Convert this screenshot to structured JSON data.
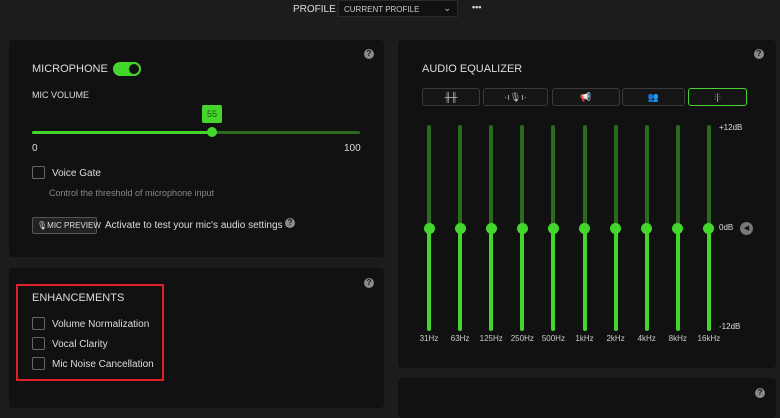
{
  "header": {
    "profile_label": "PROFILE",
    "profile_value": "CURRENT PROFILE",
    "more": "•••"
  },
  "microphone": {
    "title": "MICROPHONE",
    "enabled": true,
    "volume_label": "MIC VOLUME",
    "volume": 55,
    "min": "0",
    "max": "100",
    "value_text": "55",
    "voice_gate": "Voice Gate",
    "voice_gate_desc": "Control the threshold of microphone input",
    "preview_button": "MIC PREVIEW",
    "preview_desc": "Activate to test your mic's audio settings"
  },
  "enhancements": {
    "title": "ENHANCEMENTS",
    "items": [
      {
        "label": "Volume Normalization",
        "checked": false
      },
      {
        "label": "Vocal Clarity",
        "checked": false
      },
      {
        "label": "Mic Noise Cancellation",
        "checked": false
      }
    ]
  },
  "equalizer": {
    "title": "AUDIO EQUALIZER",
    "presets": [
      "preset-default",
      "preset-voice",
      "preset-broadcast",
      "preset-group",
      "preset-custom"
    ],
    "selected_preset": 4,
    "bands": [
      {
        "freq": "31Hz",
        "db": 0
      },
      {
        "freq": "63Hz",
        "db": 0
      },
      {
        "freq": "125Hz",
        "db": 0
      },
      {
        "freq": "250Hz",
        "db": 0
      },
      {
        "freq": "500Hz",
        "db": 0
      },
      {
        "freq": "1kHz",
        "db": 0
      },
      {
        "freq": "2kHz",
        "db": 0
      },
      {
        "freq": "4kHz",
        "db": 0
      },
      {
        "freq": "8kHz",
        "db": 0
      },
      {
        "freq": "16kHz",
        "db": 0
      }
    ],
    "scale_top": "+12dB",
    "scale_mid": "0dB",
    "scale_bot": "-12dB"
  },
  "help": "?",
  "colors": {
    "accent": "#44d62c",
    "highlight": "#e0202a"
  }
}
